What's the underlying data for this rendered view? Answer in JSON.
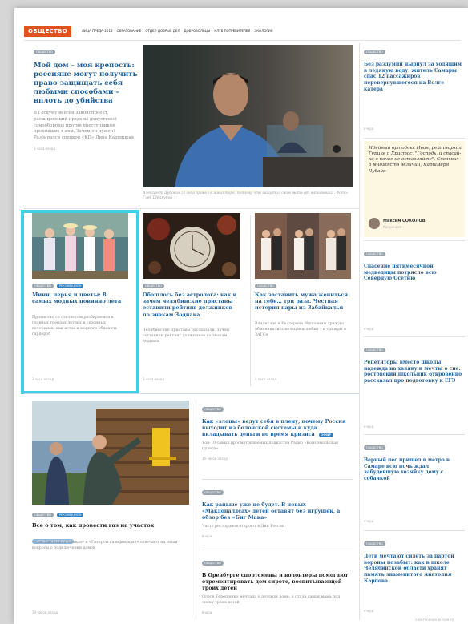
{
  "section": "ОБЩЕСТВО",
  "nav": [
    "ЛИЦА ПРЕДА-2013",
    "ОБРАЗОВАНИЕ",
    "ОТДЕЛ ДОБРЫХ ДЕЛ",
    "ДОБРОВОЛЬЦЫ",
    "КЛУБ ПОТРЕБИТЕЛЕЙ",
    "ЭКОЛОГИЯ"
  ],
  "lead": {
    "tag": "ОБЩЕСТВО",
    "title": "Мой дом – моя крепость: россияне могут получить право защищать себя любыми способами – вплоть до убийства",
    "text": "В Госдуму внесен законопроект, расширяющий пределы допустимой самообороны против преступников, проникших в дом. Зачем он нужен? Разбирался спецкор «КП» Дина Карпицкая",
    "time": "3 часа назад",
    "caption": "Александр Дубовик (3 года провел в изоляторе, потому что защитил свою мать от нападавших. Фото: Глеб Щелкунов"
  },
  "right_col": [
    {
      "tag": "ОБЩЕСТВО",
      "title": "Без раздумий нырнул за ходящим в ледяную воду: житель Самары спас 12 пассажиров перевернувшегося на Волге катера",
      "meta": "вчера"
    },
    {
      "quote": "Идейный ортодокс Иван, рейтмархал Герцке и Христос, \"Господь, и спасай-ка в почве не оставляйте\". Скольких о множеств величии, маршмеря Чубайс",
      "author": "Максим СОКОЛОВ",
      "role": "Колумнист"
    },
    {
      "tag": "ОБЩЕСТВО",
      "title": "Спасение пятимесячной медведицы потрясло всю Северную Осетию",
      "meta": "вчера"
    },
    {
      "tag": "ОБЩЕСТВО",
      "title": "Репетиторы вместо школы, надежда на халяву и мечты о сне: ростовский школьник откровенно рассказал про подготовку к ЕГЭ",
      "meta": "вчера"
    },
    {
      "tag": "ОБЩЕСТВО",
      "title": "Верный пес пришел в метро в Самаре всю ночь ждал забудевшую хозяйку дому с собачкой",
      "meta": "вчера"
    },
    {
      "tag": "ОБЩЕСТВО",
      "title": "Дети мечтают сидеть за партой вороны позабыт: как в школе Челябинской области хранят память знаменитого Анатолия Карпова",
      "meta": "вчера"
    }
  ],
  "cards": [
    {
      "tags": [
        "ОБЩЕСТВО",
        "РЕКОМЕНДУЕМ"
      ],
      "title": "Мини, перья и цветы: 8 самых модных повинно лета",
      "text": "Провистно со стилистом разбираемся в главных трендах летних и сезонных вечеринок, как встав и модного обвинить гардероб",
      "time": "3 часа назад"
    },
    {
      "tags": [
        "ОБЩЕСТВО"
      ],
      "title": "Обошлось без астролога: как и зачем челябинские приставы оставили рейтинг должников по знакам Зодиака",
      "text": "Челябинские приставы рассказали, зачем составили рейтинг должников по знакам Зодиака",
      "time": "3 часа назад"
    },
    {
      "tags": [
        "ОБЩЕСТВО"
      ],
      "title": "Как заставить мужа жениться на себе… три раза. Честная история пары из Забайкалья",
      "text": "Владислав и Екатерина Ишковины трижды обменивались кольцами любви – и трижды в ЗАГСе",
      "time": "4 часа назад"
    }
  ],
  "bottom": {
    "tags": [
      "ОБЩЕСТВО",
      "РЕКОМЕНДУЕМ"
    ],
    "title": "Все о том, как провести газ на участок",
    "label": "ПАРОВЫЕ ГАЗИФИКАЦИЯ",
    "text": "«Комсомольская правда» и «Газпром газификация» отвечают на наши вопросы о подключении домов",
    "time": "14 часов назад"
  },
  "mid_list": [
    {
      "tag": "ОБЩЕСТВО",
      "title": "Как «злоцы» ведут себя в плену, почему Россия выходит из болонской системы и куда вкладывать деньги во время кризиса",
      "badge": "ЭФИР",
      "text": "Топ-10 самых просматриваемых подкастов Радио «Комсомольская правда»",
      "time": "15 часов назад"
    },
    {
      "tag": "ОБЩЕСТВО",
      "title": "Как раньше уже не будет. В новых «Макдоналдсах» детей оставят без игрушек, а обзор без «Биг Мака»",
      "text": "Часть ресторанов откроют в Дни России",
      "time": "вчера"
    },
    {
      "tag": "ОБЩЕСТВО",
      "title": "В Оренбурге спортсмены и волонтеры помогают отремонтировать дом сироте, воспитывающей троих детей",
      "text": "Олеся Терещенко мечтала о детском доме, а стала самая мама под опеку троих детей",
      "time": "вчера"
    }
  ],
  "footer_note": "ЭЛЕКТРОННАЯ ВЕРСИЯ КП"
}
